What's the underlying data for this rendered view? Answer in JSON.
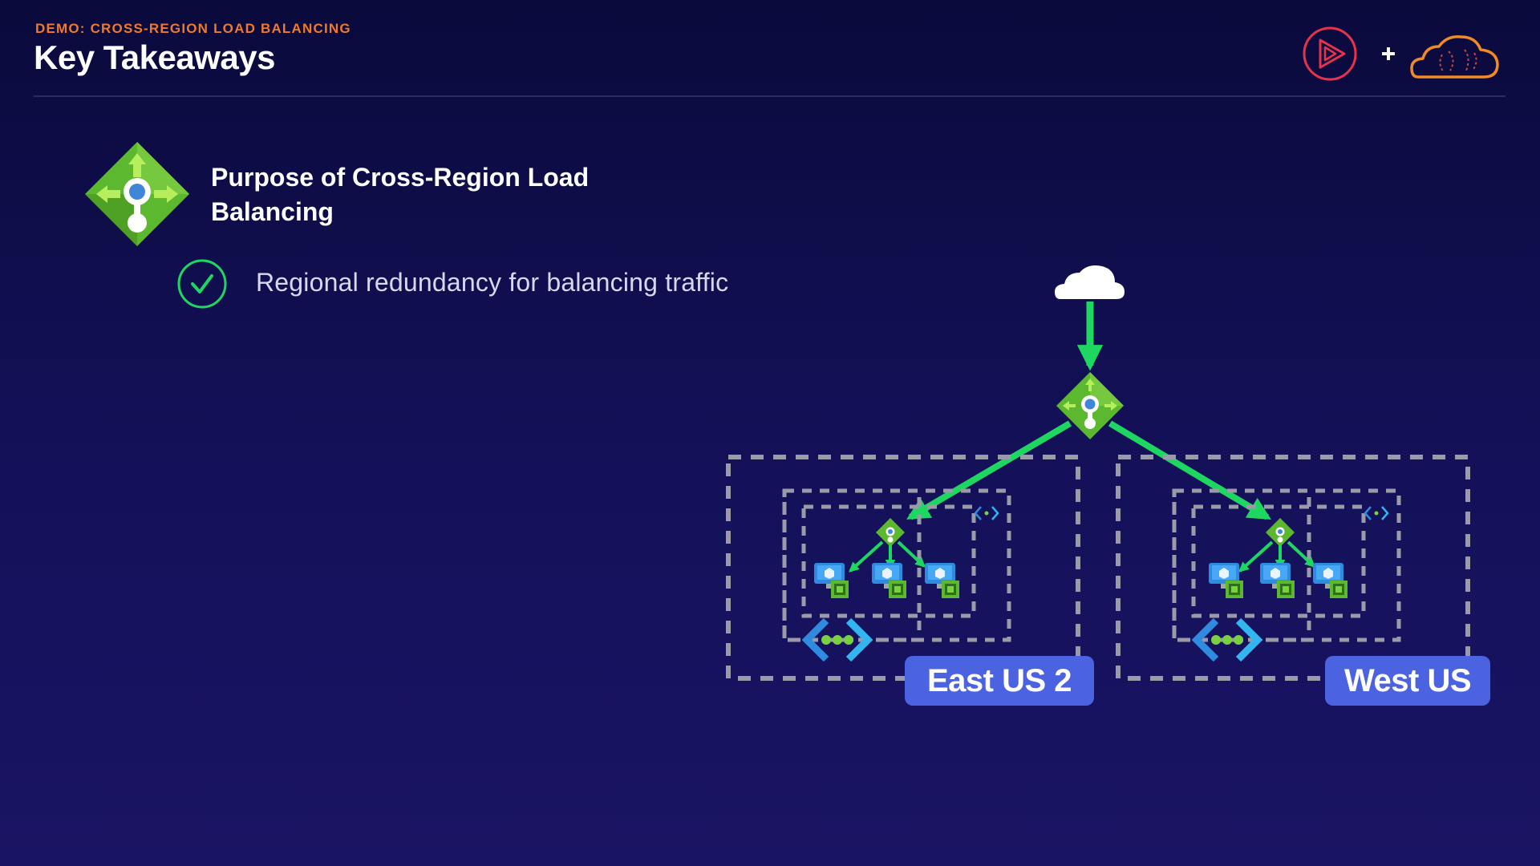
{
  "header": {
    "eyebrow": "DEMO: CROSS-REGION LOAD BALANCING",
    "title": "Key Takeaways"
  },
  "brand": {
    "logo_icon": "play-logo-icon",
    "plus": "+",
    "cloud_icon": "cloud-brain-logo-icon"
  },
  "takeaway": {
    "icon": "load-balancer-icon",
    "heading_line1": "Purpose of Cross-Region Load",
    "heading_line2": "Balancing",
    "bullets": [
      {
        "icon": "check-circle-icon",
        "text": "Regional redundancy for balancing traffic"
      }
    ]
  },
  "diagram": {
    "internet_icon": "cloud-icon",
    "global_lb_icon": "load-balancer-icon",
    "regions": [
      {
        "label": "East US 2",
        "vm_count": 3
      },
      {
        "label": "West US",
        "vm_count": 3
      }
    ]
  },
  "colors": {
    "background": "#0a0a3c",
    "eyebrow": "#f07a2a",
    "arrow_green": "#1ed760",
    "badge": "#4b63e0",
    "lb_green": "#5cb82e",
    "brand_red": "#e5334b",
    "brand_orange": "#f08a24"
  }
}
